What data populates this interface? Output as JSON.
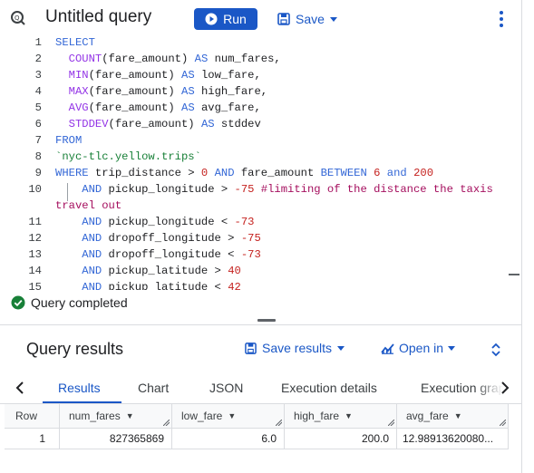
{
  "header": {
    "title": "Untitled query",
    "run_label": "Run",
    "save_label": "Save"
  },
  "editor": {
    "line_numbers": [
      "1",
      "2",
      "3",
      "4",
      "5",
      "6",
      "7",
      "8",
      "9",
      "10",
      "",
      "11",
      "12",
      "13",
      "14",
      "15"
    ],
    "lines": [
      "SELECT",
      "  COUNT(fare_amount) AS num_fares,",
      "  MIN(fare_amount) AS low_fare,",
      "  MAX(fare_amount) AS high_fare,",
      "  AVG(fare_amount) AS avg_fare,",
      "  STDDEV(fare_amount) AS stddev",
      "FROM",
      "`nyc-tlc.yellow.trips`",
      "WHERE trip_distance > 0 AND fare_amount BETWEEN 6 and 200",
      "    AND pickup_longitude > -75 #limiting of the distance the taxis",
      "travel out",
      "    AND pickup_longitude < -73",
      "    AND dropoff_longitude > -75",
      "    AND dropoff_longitude < -73",
      "    AND pickup_latitude > 40",
      "    AND pickup_latitude < 42"
    ]
  },
  "status": {
    "text": "Query completed"
  },
  "results": {
    "title": "Query results",
    "save_results_label": "Save results",
    "open_in_label": "Open in",
    "tabs": [
      "Results",
      "Chart",
      "JSON",
      "Execution details",
      "Execution graph"
    ],
    "active_tab": "Results",
    "columns": [
      "Row",
      "num_fares",
      "low_fare",
      "high_fare",
      "avg_fare"
    ],
    "rows": [
      [
        "1",
        "827365869",
        "6.0",
        "200.0",
        "12.98913620080..."
      ]
    ]
  },
  "colors": {
    "accent": "#1a57c6",
    "success": "#188038"
  }
}
